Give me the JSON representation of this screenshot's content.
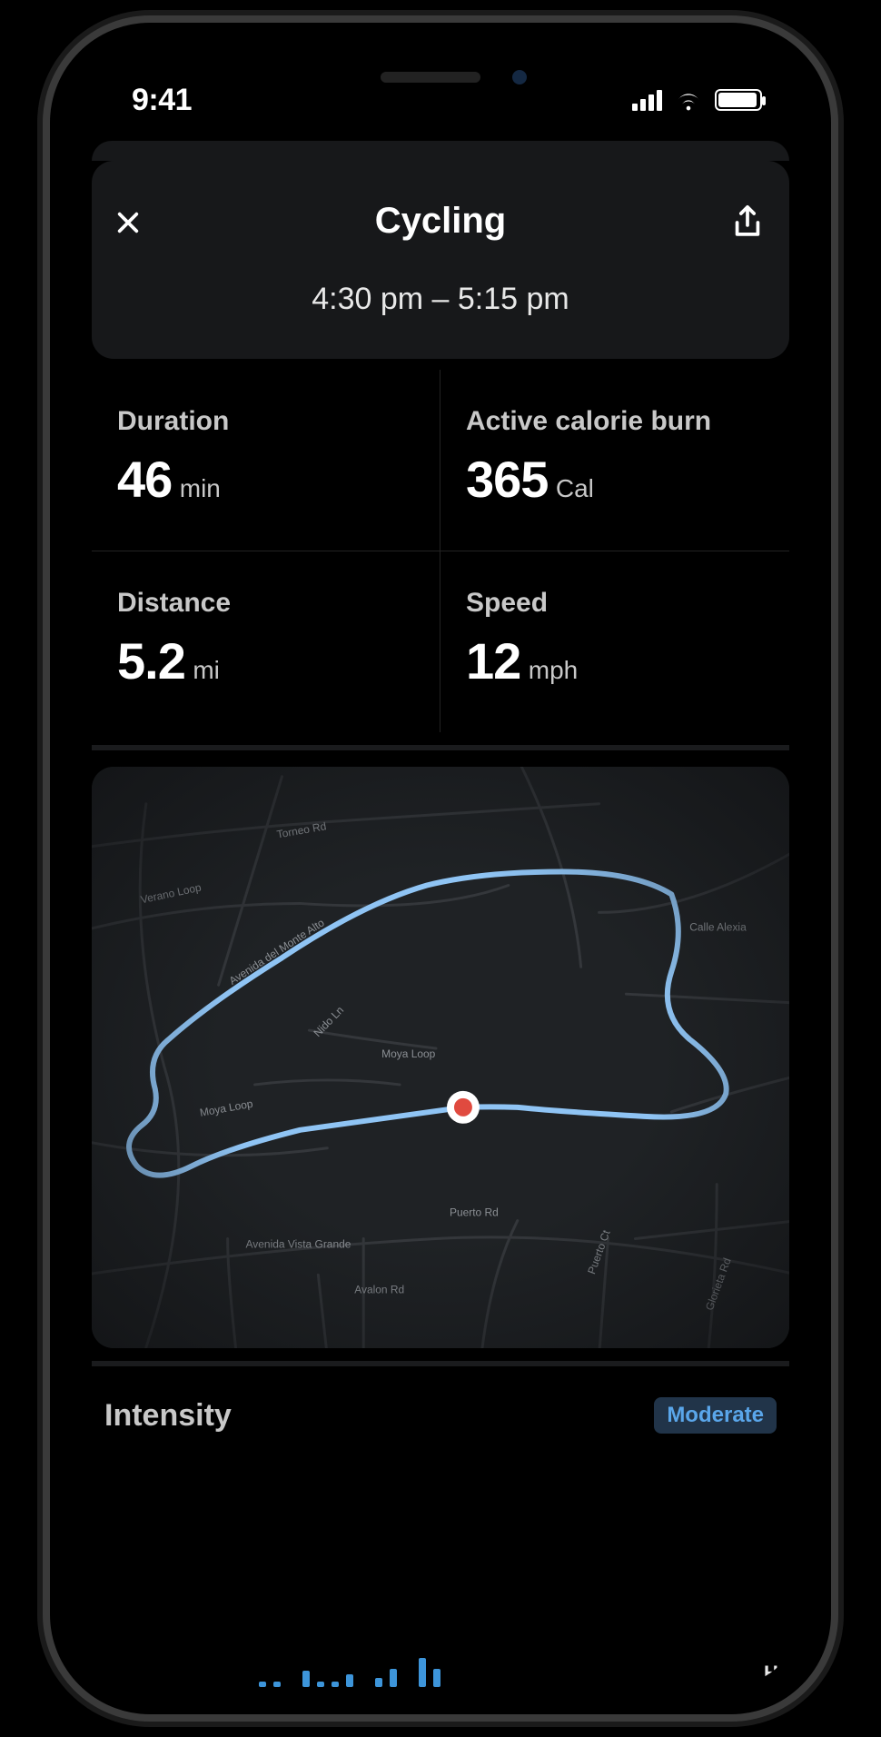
{
  "status": {
    "time": "9:41"
  },
  "header": {
    "title": "Cycling",
    "time_range": "4:30 pm – 5:15 pm"
  },
  "stats": {
    "duration": {
      "label": "Duration",
      "value": "46",
      "unit": "min"
    },
    "calories": {
      "label": "Active calorie burn",
      "value": "365",
      "unit": "Cal"
    },
    "distance": {
      "label": "Distance",
      "value": "5.2",
      "unit": "mi"
    },
    "speed": {
      "label": "Speed",
      "value": "12",
      "unit": "mph"
    }
  },
  "map": {
    "streets": [
      "Torneo Rd",
      "Verano Loop",
      "Avenida del Monte Alto",
      "Nido Ln",
      "Moya Loop",
      "Moya Loop",
      "Calle Alexia",
      "Puerto Rd",
      "Avenida Vista Grande",
      "Avalon Rd",
      "Puerto Ct",
      "Glorieta Rd"
    ]
  },
  "intensity": {
    "label": "Intensity",
    "badge": "Moderate",
    "axis_high": "Hi"
  }
}
